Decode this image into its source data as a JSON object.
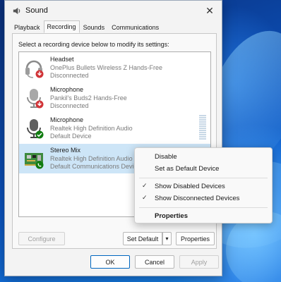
{
  "window": {
    "title": "Sound",
    "close_glyph": "✕"
  },
  "tabs": [
    {
      "label": "Playback",
      "active": false
    },
    {
      "label": "Recording",
      "active": true
    },
    {
      "label": "Sounds",
      "active": false
    },
    {
      "label": "Communications",
      "active": false
    }
  ],
  "instruction": "Select a recording device below to modify its settings:",
  "devices": [
    {
      "name": "Headset",
      "description": "OnePlus Bullets Wireless Z Hands-Free",
      "status": "Disconnected",
      "icon": "headset-icon",
      "badge": "disconnected-badge-icon",
      "selected": false
    },
    {
      "name": "Microphone",
      "description": "Pankil's Buds2 Hands-Free",
      "status": "Disconnected",
      "icon": "microphone-icon",
      "badge": "disconnected-badge-icon",
      "selected": false
    },
    {
      "name": "Microphone",
      "description": "Realtek High Definition Audio",
      "status": "Default Device",
      "icon": "microphone-icon",
      "badge": "default-check-badge-icon",
      "selected": false
    },
    {
      "name": "Stereo Mix",
      "description": "Realtek High Definition Audio",
      "status": "Default Communications Device",
      "icon": "circuit-board-icon",
      "badge": "communications-phone-badge-icon",
      "selected": true
    }
  ],
  "buttons": {
    "configure": "Configure",
    "set_default": "Set Default",
    "set_default_arrow": "▾",
    "properties": "Properties",
    "ok": "OK",
    "cancel": "Cancel",
    "apply": "Apply"
  },
  "context_menu": {
    "items": [
      {
        "label": "Disable",
        "checked": false,
        "bold": false
      },
      {
        "label": "Set as Default Device",
        "checked": false,
        "bold": false
      },
      {
        "label": "Show Disabled Devices",
        "checked": true,
        "bold": false
      },
      {
        "label": "Show Disconnected Devices",
        "checked": true,
        "bold": false
      },
      {
        "label": "Properties",
        "checked": false,
        "bold": true
      }
    ],
    "check_glyph": "✓"
  },
  "colors": {
    "selection": "#cde5f7",
    "accent": "#0067c0",
    "disconnected_badge": "#d13438",
    "default_badge": "#107c10"
  }
}
